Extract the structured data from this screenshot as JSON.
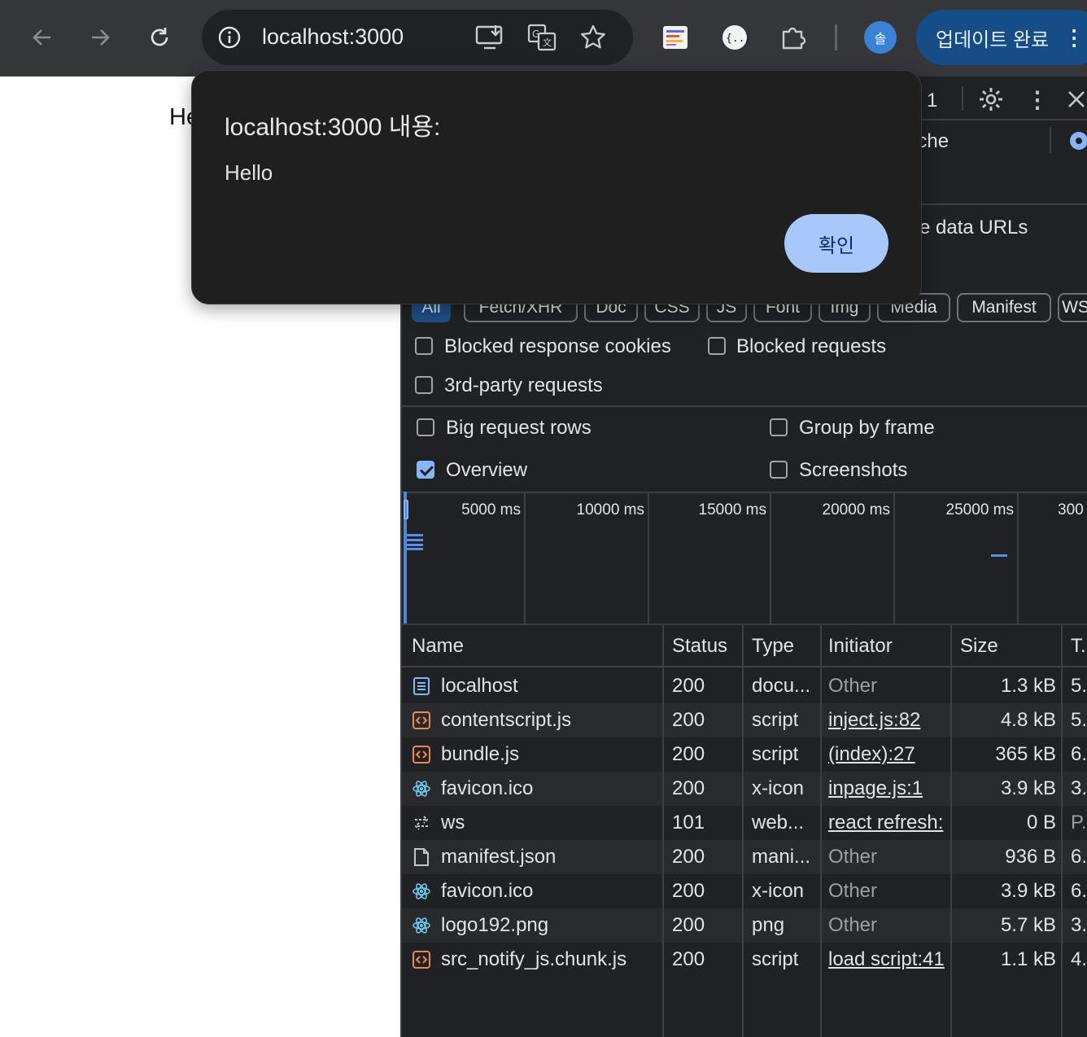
{
  "toolbar": {
    "url": "localhost:3000",
    "profile_initial": "솔",
    "update_label": "업데이트 완료"
  },
  "page": {
    "text": "Hello"
  },
  "devtools": {
    "error_count": "1",
    "disable_cache_partial": "ache",
    "hide_data_urls_partial": "e data URLs",
    "filters": [
      "All",
      "Fetch/XHR",
      "Doc",
      "CSS",
      "JS",
      "Font",
      "Img",
      "Media",
      "Manifest",
      "WS"
    ],
    "checkboxes": {
      "blocked_cookies": "Blocked response cookies",
      "blocked_requests": "Blocked requests",
      "third_party": "3rd-party requests",
      "big_rows": "Big request rows",
      "group_by_frame": "Group by frame",
      "overview": "Overview",
      "screenshots": "Screenshots"
    },
    "checkbox_states": {
      "overview": true
    },
    "timeline_ticks": [
      "5000 ms",
      "10000 ms",
      "15000 ms",
      "20000 ms",
      "25000 ms",
      "300"
    ],
    "columns": [
      "Name",
      "Status",
      "Type",
      "Initiator",
      "Size",
      "T."
    ],
    "rows": [
      {
        "icon": "document-icon",
        "name": "localhost",
        "status": "200",
        "type": "docu...",
        "initiator": "Other",
        "initiator_link": false,
        "size": "1.3 kB",
        "time": "5."
      },
      {
        "icon": "script-icon",
        "name": "contentscript.js",
        "status": "200",
        "type": "script",
        "initiator": "inject.js:82",
        "initiator_link": true,
        "size": "4.8 kB",
        "time": "5."
      },
      {
        "icon": "script-icon",
        "name": "bundle.js",
        "status": "200",
        "type": "script",
        "initiator": "(index):27",
        "initiator_link": true,
        "size": "365 kB",
        "time": "6."
      },
      {
        "icon": "react-icon",
        "name": "favicon.ico",
        "status": "200",
        "type": "x-icon",
        "initiator": "inpage.js:1",
        "initiator_link": true,
        "size": "3.9 kB",
        "time": "3."
      },
      {
        "icon": "websocket-icon",
        "name": "ws",
        "status": "101",
        "type": "web...",
        "initiator": "react refresh:",
        "initiator_link": true,
        "size": "0 B",
        "time": "P."
      },
      {
        "icon": "manifest-icon",
        "name": "manifest.json",
        "status": "200",
        "type": "mani...",
        "initiator": "Other",
        "initiator_link": false,
        "size": "936 B",
        "time": "6."
      },
      {
        "icon": "react-icon",
        "name": "favicon.ico",
        "status": "200",
        "type": "x-icon",
        "initiator": "Other",
        "initiator_link": false,
        "size": "3.9 kB",
        "time": "6."
      },
      {
        "icon": "react-icon",
        "name": "logo192.png",
        "status": "200",
        "type": "png",
        "initiator": "Other",
        "initiator_link": false,
        "size": "5.7 kB",
        "time": "3."
      },
      {
        "icon": "script-icon",
        "name": "src_notify_js.chunk.js",
        "status": "200",
        "type": "script",
        "initiator": "load script:41",
        "initiator_link": true,
        "size": "1.1 kB",
        "time": "4."
      }
    ]
  },
  "dialog": {
    "title": "localhost:3000 내용:",
    "message": "Hello",
    "ok_label": "확인"
  },
  "colors": {
    "toolbar_bg": "#35363a",
    "devtools_bg": "#202124",
    "accent": "#8ab4f8",
    "dialog_button": "#a8c7fa"
  }
}
